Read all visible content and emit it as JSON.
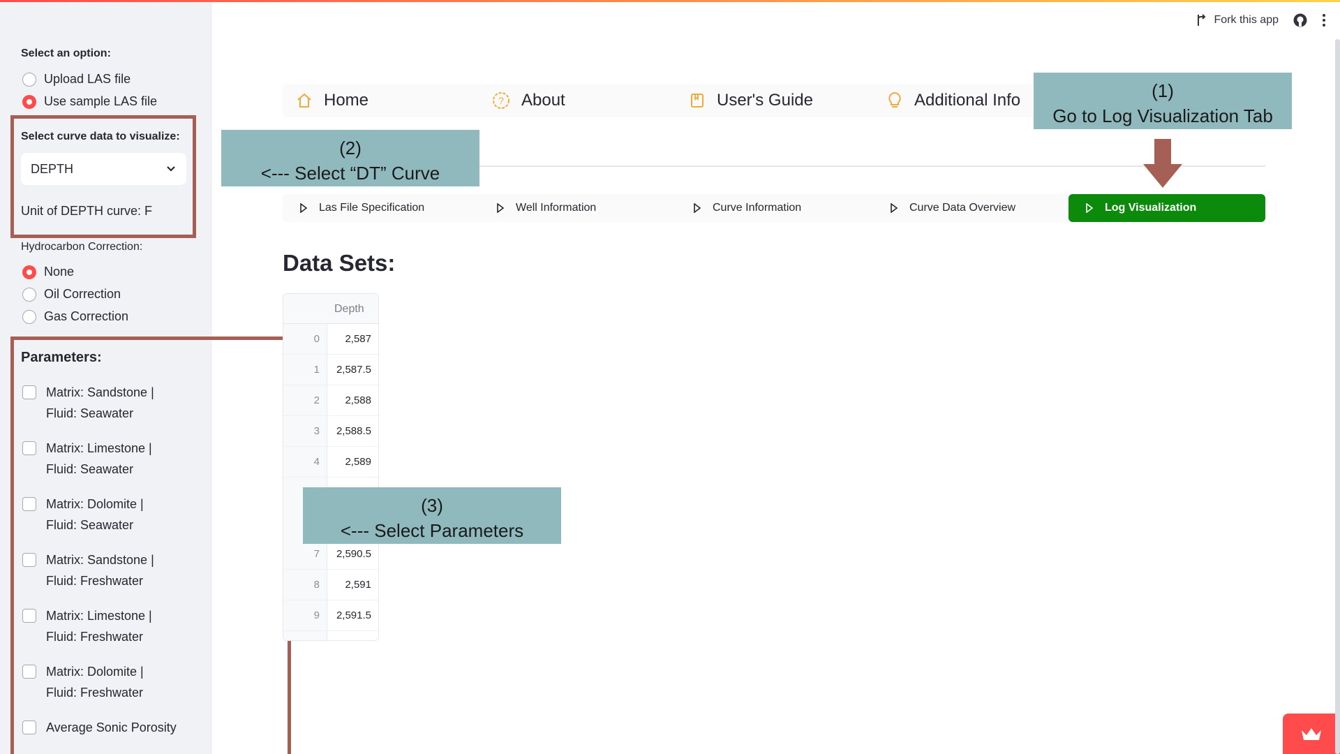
{
  "sidebar": {
    "select_option_label": "Select an option:",
    "options": [
      "Upload LAS file",
      "Use sample LAS file"
    ],
    "curve_label": "Select curve data to visualize:",
    "curve_selected": "DEPTH",
    "unit_text": "Unit of DEPTH curve: F",
    "hc_label": "Hydrocarbon Correction:",
    "hc_options": [
      "None",
      "Oil Correction",
      "Gas Correction"
    ],
    "params_label": "Parameters:",
    "params": [
      {
        "line1": "Matrix: Sandstone |",
        "line2": "Fluid: Seawater"
      },
      {
        "line1": "Matrix: Limestone |",
        "line2": "Fluid: Seawater"
      },
      {
        "line1": "Matrix: Dolomite |",
        "line2": "Fluid: Seawater"
      },
      {
        "line1": "Matrix: Sandstone |",
        "line2": "Fluid: Freshwater"
      },
      {
        "line1": "Matrix: Limestone |",
        "line2": "Fluid: Freshwater"
      },
      {
        "line1": "Matrix: Dolomite |",
        "line2": "Fluid: Freshwater"
      },
      {
        "line1": "Average Sonic Porosity",
        "line2": ""
      }
    ]
  },
  "toolbar": {
    "fork_label": "Fork this app"
  },
  "nav": {
    "items": [
      "Home",
      "About",
      "User's Guide",
      "Additional Info"
    ]
  },
  "tabs": [
    "Las File Specification",
    "Well Information",
    "Curve Information",
    "Curve Data Overview",
    "Log Visualization"
  ],
  "main": {
    "heading": "Data Sets:"
  },
  "table": {
    "header": "Depth",
    "rows": [
      {
        "idx": "0",
        "val": "2,587"
      },
      {
        "idx": "1",
        "val": "2,587.5"
      },
      {
        "idx": "2",
        "val": "2,588"
      },
      {
        "idx": "3",
        "val": "2,588.5"
      },
      {
        "idx": "4",
        "val": "2,589"
      },
      {
        "idx": "7",
        "val": "2,590.5"
      },
      {
        "idx": "8",
        "val": "2,591"
      },
      {
        "idx": "9",
        "val": "2,591.5"
      }
    ]
  },
  "callouts": {
    "c1": {
      "num": "(1)",
      "text": "Go to Log Visualization Tab"
    },
    "c2": {
      "num": "(2)",
      "text": "<--- Select “DT” Curve"
    },
    "c3": {
      "num": "(3)",
      "text": "<--- Select Parameters"
    }
  },
  "colors": {
    "accent": "#ff4b4b",
    "active_tab": "#0b8a0b",
    "highlight": "#a55f55",
    "callout": "#8fb9bd"
  }
}
